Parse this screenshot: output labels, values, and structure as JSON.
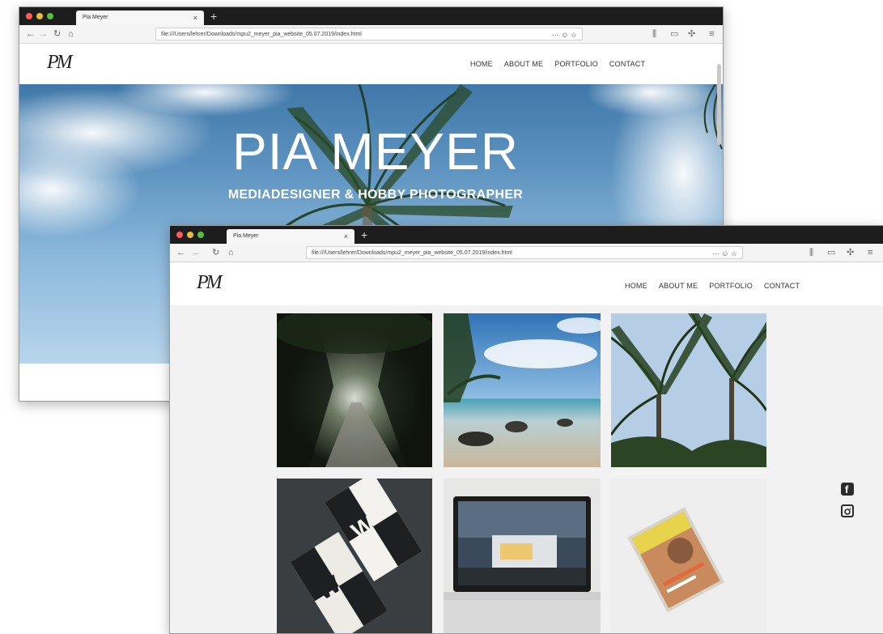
{
  "window_back": {
    "tab_title": "Pia Meyer",
    "url": "file:///Users/lehrer/Downloads/mpu2_meyer_pia_website_05.07.2019/index.html",
    "url_actions": "··· ☺ ☆",
    "logo": "PM",
    "nav": [
      "HOME",
      "ABOUT ME",
      "PORTFOLIO",
      "CONTACT"
    ],
    "hero_title": "PIA MEYER",
    "hero_subtitle": "MEDIADESIGNER & HOBBY PHOTOGRAPHER"
  },
  "window_front": {
    "tab_title": "Pia Meyer",
    "url": "file:///Users/lehrer/Downloads/mpu2_meyer_pia_website_05.07.2019/index.html",
    "url_actions": "··· ☺ ☆",
    "logo": "PM",
    "nav": [
      "HOME",
      "ABOUT ME",
      "PORTFOLIO",
      "CONTACT"
    ],
    "gallery": [
      {
        "name": "forest-path-photo"
      },
      {
        "name": "beach-photo"
      },
      {
        "name": "palm-trees-photo"
      },
      {
        "name": "business-cards-mockup"
      },
      {
        "name": "laptop-mockup"
      },
      {
        "name": "magazine-mockup"
      }
    ],
    "social_icons": [
      "facebook-icon",
      "instagram-icon"
    ]
  },
  "colors": {
    "titlebar": "#1d1d1d",
    "dot_red": "#fc5b57",
    "dot_yellow": "#e5bf3c",
    "dot_green": "#57c038",
    "sky": "#5d93c0"
  }
}
